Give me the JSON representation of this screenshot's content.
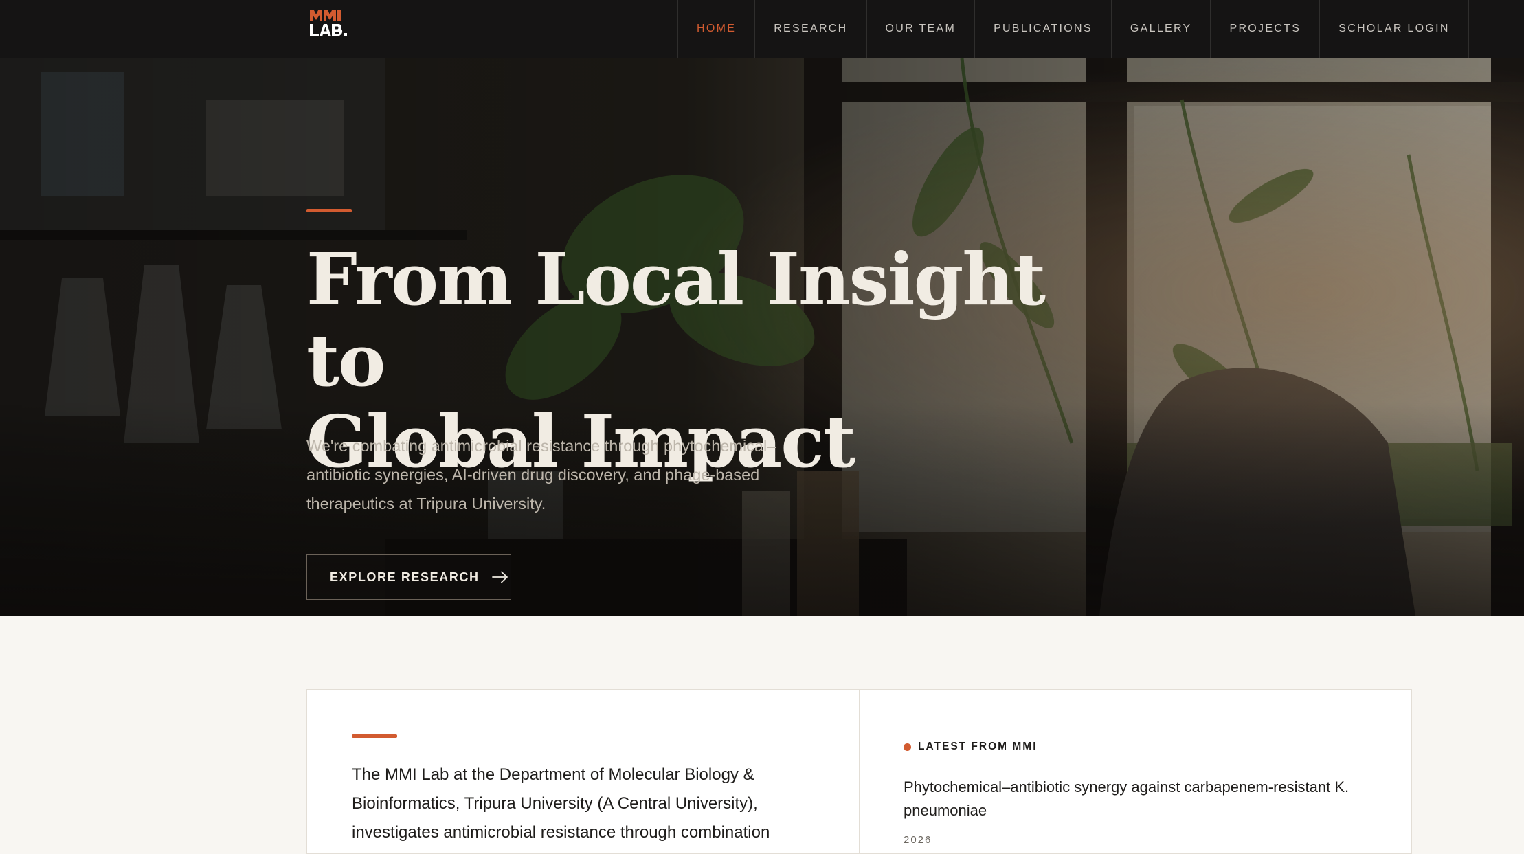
{
  "nav": {
    "logo": {
      "line1": "MMI",
      "line2": "LAB."
    },
    "items": [
      {
        "label": "Home",
        "active": true
      },
      {
        "label": "Research"
      },
      {
        "label": "Our Team"
      },
      {
        "label": "Publications"
      },
      {
        "label": "Gallery"
      },
      {
        "label": "Projects"
      },
      {
        "label": "Scholar Login"
      }
    ]
  },
  "hero": {
    "title_line1": "From Local Insight to",
    "title_line2": "Global Impact",
    "subtitle": "We're combating antimicrobial resistance through phytochemical–antibiotic synergies, AI-driven drug discovery, and phage-based therapeutics at Tripura University.",
    "cta_label": "Explore Research",
    "cta_icon": "arrow-right-icon"
  },
  "about": {
    "intro": "The MMI Lab at the Department of Molecular Biology & Bioinformatics, Tripura University (A Central University), investigates antimicrobial resistance through combination"
  },
  "latest": {
    "label": "Latest from MMI",
    "title": "Phytochemical–antibiotic synergy against carbapenem-resistant K. pneumoniae",
    "year": "2026"
  },
  "colors": {
    "accent": "#d25b30",
    "nav_bg": "#151414",
    "page_bg": "#f8f6f2",
    "hero_text": "#f1ece3"
  }
}
